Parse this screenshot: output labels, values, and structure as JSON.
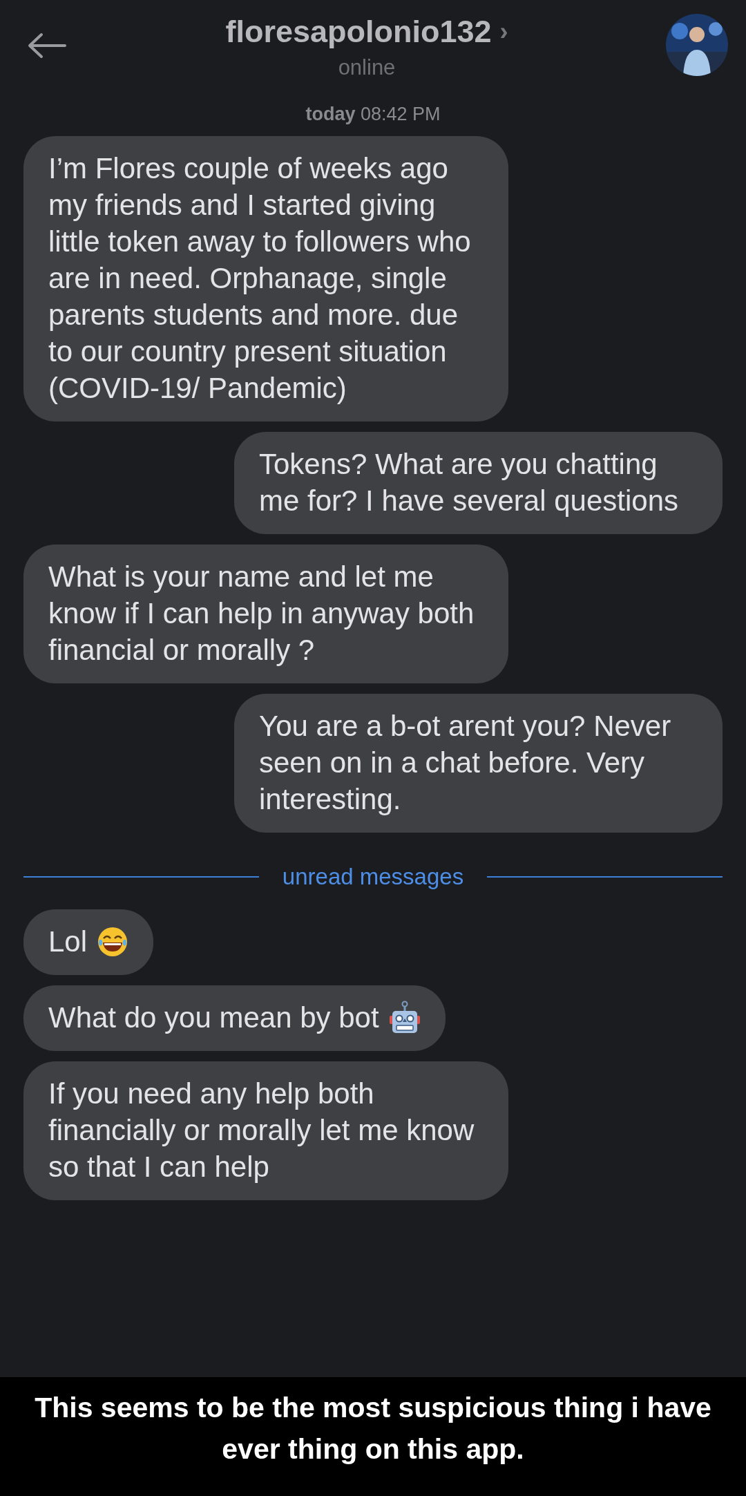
{
  "header": {
    "title": "floresapolonio132",
    "chevron": "›",
    "status": "online"
  },
  "date_label": {
    "day": "today",
    "time": "08:42 PM"
  },
  "messages": [
    {
      "kind": "incoming",
      "text": "I’m Flores couple of weeks ago my friends and I started giving little token away to followers who are in need. Orphanage, single parents students and more. due to our country present situation (COVID-19/ Pandemic)"
    },
    {
      "kind": "outgoing",
      "text": "Tokens? What are you chatting me for? I have several questions"
    },
    {
      "kind": "incoming",
      "text": "What is your name and let me know if I can help in anyway both financial or morally ?"
    },
    {
      "kind": "outgoing",
      "text": "You are a b-ot arent you? Never seen on in a chat before. Very interesting."
    },
    {
      "kind": "divider",
      "text": "unread messages"
    },
    {
      "kind": "emoji",
      "text": "Lol"
    },
    {
      "kind": "emoji",
      "text": "What do you mean by bot"
    },
    {
      "kind": "incoming",
      "text": "If you need any help both financially or morally let me know so that I can help"
    }
  ],
  "caption": "This seems to be the most suspicious thing i have ever thing on this app."
}
